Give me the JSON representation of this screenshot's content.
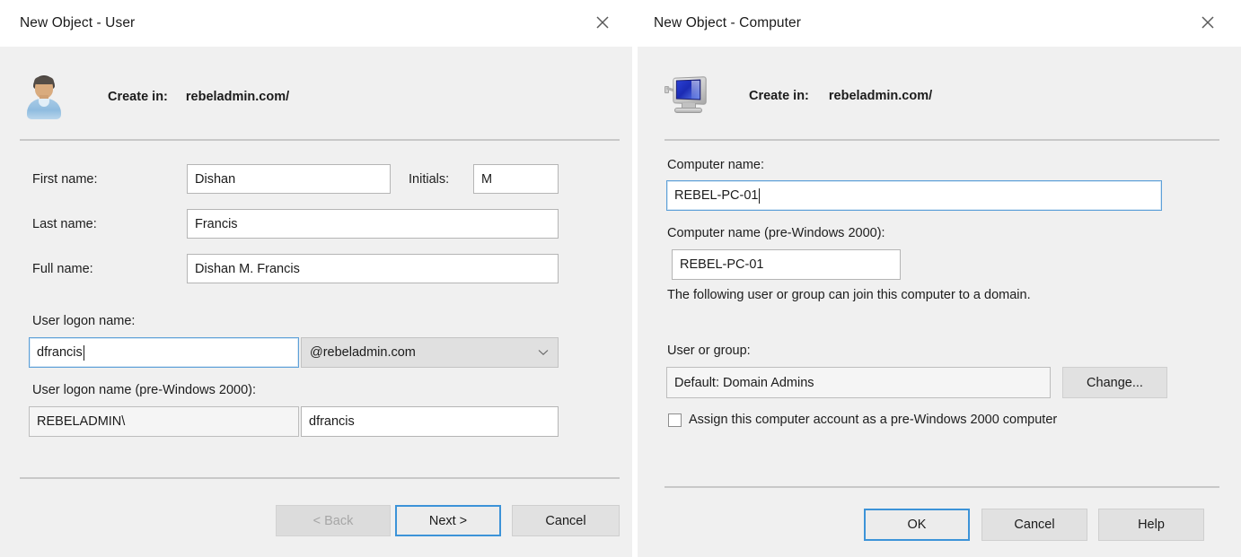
{
  "user_dialog": {
    "title": "New Object - User",
    "close_icon": "close-icon",
    "object_icon": "user-icon",
    "create_in_label": "Create in:",
    "create_in_value": "rebeladmin.com/",
    "fields": {
      "first_name_label": "First name:",
      "first_name_value": "Dishan",
      "initials_label": "Initials:",
      "initials_value": "M",
      "last_name_label": "Last name:",
      "last_name_value": "Francis",
      "full_name_label": "Full name:",
      "full_name_value": "Dishan M. Francis",
      "logon_name_label": "User logon name:",
      "logon_name_value": "dfrancis",
      "upn_suffix_value": "@rebeladmin.com",
      "upn_suffix_icon": "chevron-down-icon",
      "logon_name_pre2000_label": "User logon name (pre-Windows 2000):",
      "domain_prefix_value": "REBELADMIN\\",
      "sam_account_value": "dfrancis"
    },
    "buttons": {
      "back": "< Back",
      "next": "Next >",
      "cancel": "Cancel"
    }
  },
  "computer_dialog": {
    "title": "New Object - Computer",
    "close_icon": "close-icon",
    "object_icon": "computer-icon",
    "create_in_label": "Create in:",
    "create_in_value": "rebeladmin.com/",
    "fields": {
      "computer_name_label": "Computer name:",
      "computer_name_value": "REBEL-PC-01",
      "computer_name_pre2000_label": "Computer name (pre-Windows 2000):",
      "computer_name_pre2000_value": "REBEL-PC-01",
      "hint_text": "The following user or group can join this computer to a domain.",
      "user_or_group_label": "User or group:",
      "user_or_group_value": "Default: Domain Admins",
      "change_button": "Change...",
      "assign_checkbox_label": "Assign this computer account as a pre-Windows 2000 computer",
      "assign_checkbox_checked": false
    },
    "buttons": {
      "ok": "OK",
      "cancel": "Cancel",
      "help": "Help"
    }
  },
  "colors": {
    "dialog_background": "#f0f0f0",
    "titlebar_background": "#ffffff",
    "focus_border": "#3c93d8",
    "field_border": "#b5b5b5",
    "text": "#1b1b1b",
    "disabled_text": "#a6a6a6",
    "combobox_background": "#e0e0e0"
  }
}
